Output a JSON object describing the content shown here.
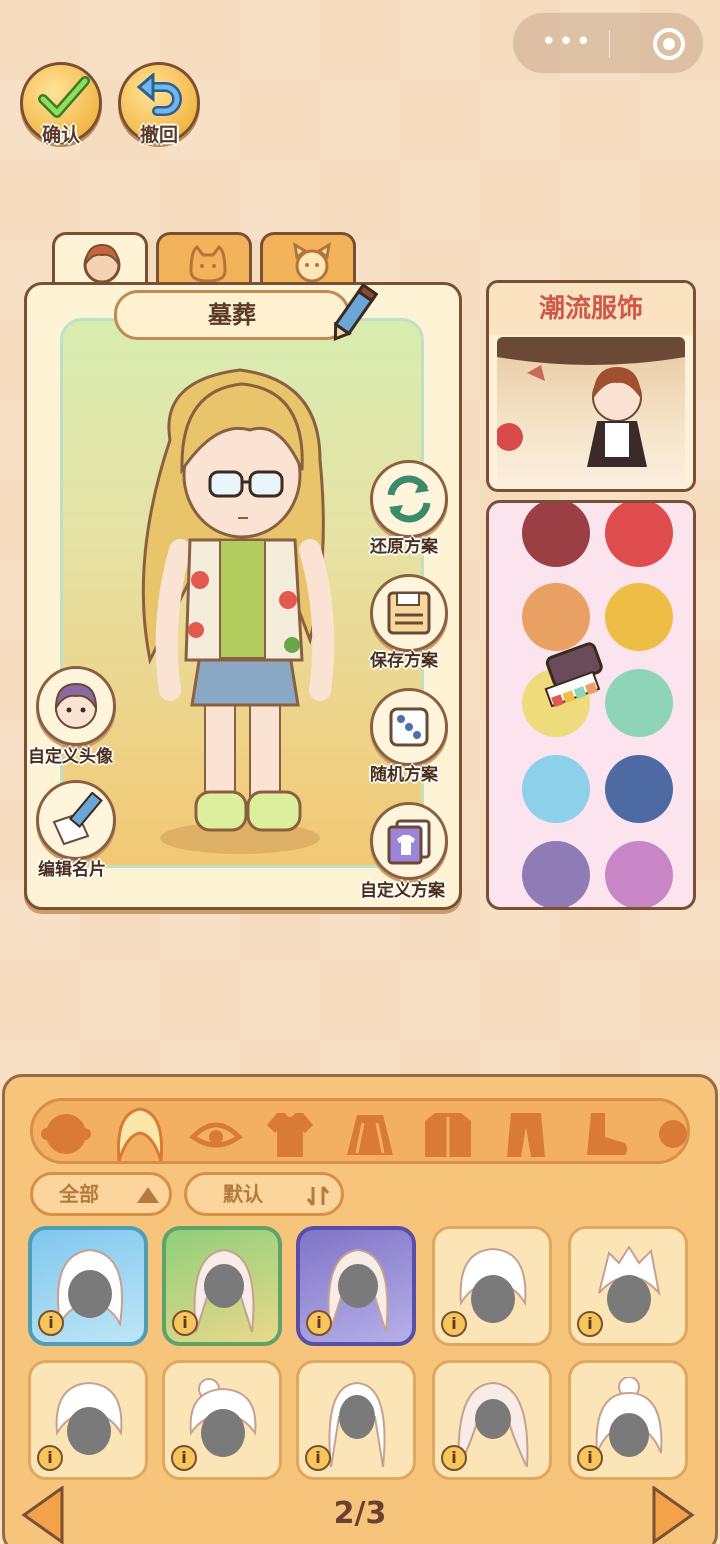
{
  "top_buttons": {
    "confirm_label": "确认",
    "undo_label": "撤回"
  },
  "character": {
    "name": "墓葬"
  },
  "side_actions": {
    "restore_label": "还原方案",
    "save_label": "保存方案",
    "random_label": "随机方案",
    "custom_label": "自定义方案",
    "custom_avatar_label": "自定义头像",
    "edit_card_label": "编辑名片"
  },
  "trend": {
    "title": "潮流服饰"
  },
  "palette": {
    "colors": [
      "#9c3f45",
      "#de4c4e",
      "#e9a063",
      "#edbd45",
      "#eedb7c",
      "#8fd3b8",
      "#8cd0ea",
      "#4e6aa2",
      "#8f7bb6",
      "#c986c6"
    ]
  },
  "filters": {
    "category_label": "全部",
    "sort_label": "默认"
  },
  "category_icons": [
    "face-icon",
    "hair-icon",
    "eye-icon",
    "top-icon",
    "skirt-icon",
    "coat-icon",
    "pants-icon",
    "shoes-icon",
    "accessory-icon"
  ],
  "items_info": "i",
  "pager": {
    "text": "2/3"
  }
}
